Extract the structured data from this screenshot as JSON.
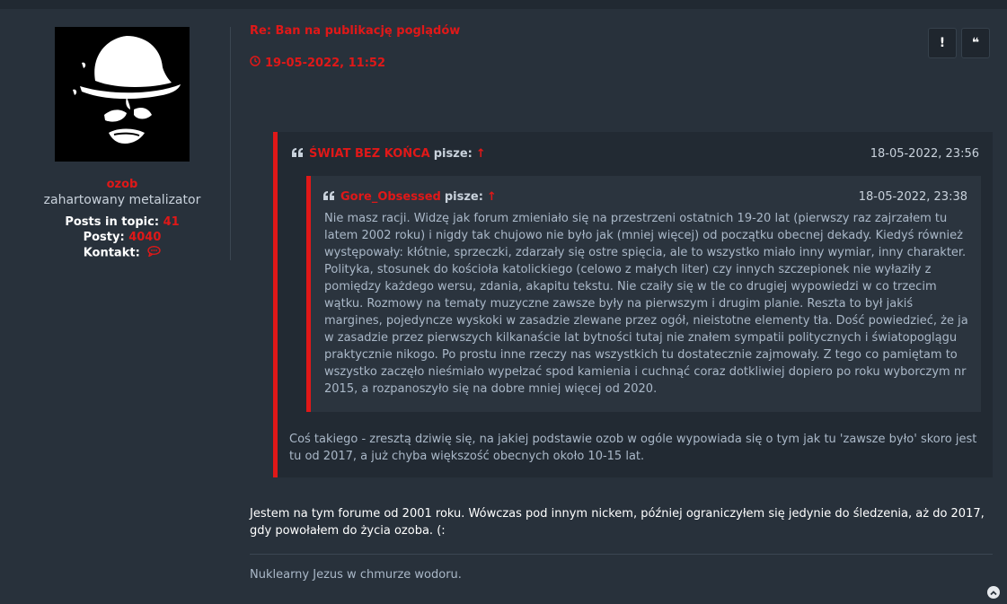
{
  "profile": {
    "username": "ozob",
    "rank": "zahartowany metalizator",
    "posts_in_topic_label": "Posts in topic:",
    "posts_in_topic_value": "41",
    "posts_label": "Posty:",
    "posts_value": "4040",
    "contact_label": "Kontakt:",
    "contact_icon": "chat-bubble-icon"
  },
  "post": {
    "title": "Re: Ban na publikację poglądów",
    "date": "19-05-2022, 11:52",
    "buttons": {
      "report": "!",
      "quote": "❝"
    },
    "outer_quote": {
      "author": "ŚWIAT BEZ KOŃCA",
      "says": "pisze:",
      "arrow": "↑",
      "date": "18-05-2022, 23:56",
      "inner_quote": {
        "author": "Gore_Obsessed",
        "says": "pisze:",
        "arrow": "↑",
        "date": "18-05-2022, 23:38",
        "body": "Nie masz racji. Widzę jak forum zmieniało się na przestrzeni ostatnich 19-20 lat (pierwszy raz zajrzałem tu latem 2002 roku) i nigdy tak chujowo nie było jak (mniej więcej) od początku obecnej dekady. Kiedyś również występowały: kłótnie, sprzeczki, zdarzały się ostre spięcia, ale to wszystko miało inny wymiar, inny charakter. Polityka, stosunek do kościoła katolickiego (celowo z małych liter) czy innych szczepionek nie wyłaziły z pomiędzy każdego wersu, zdania, akapitu tekstu. Nie czaiły się w tle co drugiej wypowiedzi w co trzecim wątku. Rozmowy na tematy muzyczne zawsze były na pierwszym i drugim planie. Reszta to był jakiś margines, pojedyncze wyskoki w zasadzie zlewane przez ogół, nieistotne elementy tła. Dość powiedzieć, że ja w zasadzie przez pierwszych kilkanaście lat bytności tutaj nie znałem sympatii politycznych i światopoglągu praktycznie nikogo. Po prostu inne rzeczy nas wszystkich tu dostatecznie zajmowały. Z tego co pamiętam to wszystko zaczęło nieśmiało wypełzać spod kamienia i cuchnąć coraz dotkliwiej dopiero po roku wyborczym nr 2015, a rozpanoszyło się na dobre mniej więcej od 2020."
      },
      "body": "Coś takiego - zresztą dziwię się, na jakiej podstawie ozob w ogóle wypowiada się o tym jak tu 'zawsze było' skoro jest tu od 2017, a już chyba większość obecnych około 10-15 lat."
    },
    "body": "Jestem na tym forume od 2001 roku. Wówczas pod innym nickem, później ograniczyłem się jedynie do śledzenia, aż do 2017, gdy powołałem do życia ozoba. (:",
    "signature": "Nuklearny Jezus w chmurze wodoru."
  },
  "colors": {
    "background": "#28313b",
    "accent": "#e01818",
    "quote_bg": "#222a33",
    "inner_quote_bg": "#2b343e",
    "muted_text": "#aab8c8"
  }
}
